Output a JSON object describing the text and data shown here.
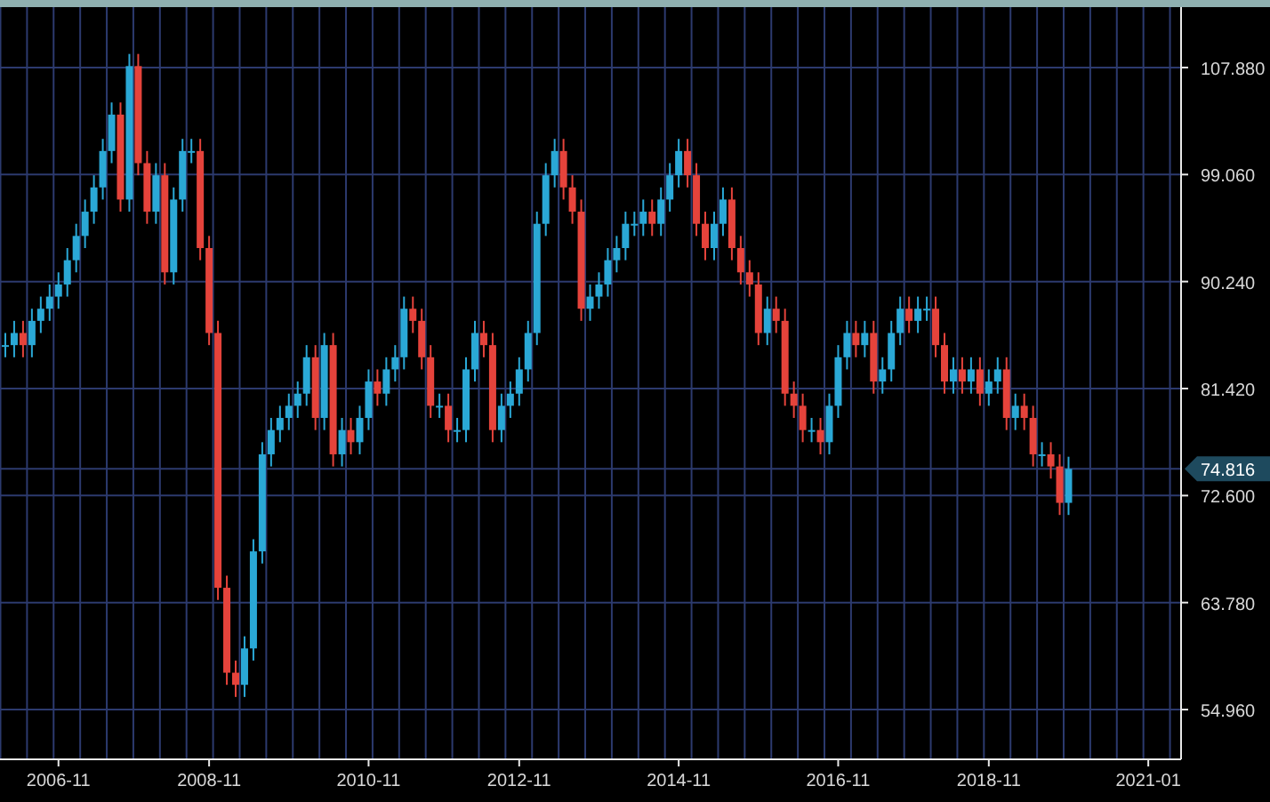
{
  "chart": {
    "chart_data": {
      "type": "candlestick",
      "grid": true,
      "categories": [
        null,
        null,
        null,
        null,
        null,
        null,
        "2006-11",
        null,
        null,
        null,
        null,
        null,
        null,
        null,
        null,
        null,
        null,
        null,
        null,
        null,
        null,
        null,
        null,
        "2008-11",
        null,
        null,
        null,
        null,
        null,
        null,
        null,
        null,
        null,
        null,
        null,
        null,
        null,
        null,
        null,
        null,
        null,
        "2010-11",
        null,
        null,
        null,
        null,
        null,
        null,
        null,
        null,
        null,
        null,
        null,
        null,
        null,
        null,
        null,
        null,
        "2012-11",
        null,
        null,
        null,
        null,
        null,
        null,
        null,
        null,
        null,
        null,
        null,
        null,
        null,
        null,
        null,
        null,
        null,
        "2014-11",
        null,
        null,
        null,
        null,
        null,
        null,
        null,
        null,
        null,
        null,
        null,
        null,
        null,
        null,
        null,
        null,
        null,
        "2016-11",
        null,
        null,
        null,
        null,
        null,
        null,
        null,
        null,
        null,
        null,
        null,
        null,
        null,
        null,
        null,
        null,
        "2018-11",
        null,
        null,
        null,
        null,
        null,
        null,
        null,
        null,
        null,
        null,
        null,
        null,
        null,
        null,
        null,
        null,
        null,
        "2021-01"
      ],
      "ohlc": [
        [
          85,
          86,
          84,
          85
        ],
        [
          85,
          87,
          84,
          86
        ],
        [
          86,
          87,
          84,
          85
        ],
        [
          85,
          88,
          84,
          87
        ],
        [
          87,
          89,
          86,
          88
        ],
        [
          88,
          90,
          87,
          89
        ],
        [
          89,
          91,
          88,
          90
        ],
        [
          90,
          93,
          89,
          92
        ],
        [
          92,
          95,
          91,
          94
        ],
        [
          94,
          97,
          93,
          96
        ],
        [
          96,
          99,
          95,
          98
        ],
        [
          98,
          102,
          97,
          101
        ],
        [
          101,
          105,
          100,
          104
        ],
        [
          104,
          105,
          96,
          97
        ],
        [
          97,
          109,
          96,
          108
        ],
        [
          108,
          109,
          99,
          100
        ],
        [
          100,
          101,
          95,
          96
        ],
        [
          96,
          100,
          95,
          99
        ],
        [
          99,
          100,
          90,
          91
        ],
        [
          91,
          98,
          90,
          97
        ],
        [
          97,
          102,
          96,
          101
        ],
        [
          101,
          102,
          100,
          101
        ],
        [
          101,
          102,
          92,
          93
        ],
        [
          93,
          94,
          85,
          86
        ],
        [
          86,
          87,
          64,
          65
        ],
        [
          65,
          66,
          57,
          58
        ],
        [
          58,
          59,
          56,
          57
        ],
        [
          57,
          61,
          56,
          60
        ],
        [
          60,
          69,
          59,
          68
        ],
        [
          68,
          77,
          67,
          76
        ],
        [
          76,
          79,
          75,
          78
        ],
        [
          78,
          80,
          77,
          79
        ],
        [
          79,
          81,
          78,
          80
        ],
        [
          80,
          82,
          79,
          81
        ],
        [
          81,
          85,
          80,
          84
        ],
        [
          84,
          85,
          78,
          79
        ],
        [
          79,
          86,
          78,
          85
        ],
        [
          85,
          86,
          75,
          76
        ],
        [
          76,
          79,
          75,
          78
        ],
        [
          78,
          79,
          76,
          77
        ],
        [
          77,
          80,
          76,
          79
        ],
        [
          79,
          83,
          78,
          82
        ],
        [
          82,
          83,
          80,
          81
        ],
        [
          81,
          84,
          80,
          83
        ],
        [
          83,
          85,
          82,
          84
        ],
        [
          84,
          89,
          83,
          88
        ],
        [
          88,
          89,
          86,
          87
        ],
        [
          87,
          88,
          83,
          84
        ],
        [
          84,
          85,
          79,
          80
        ],
        [
          80,
          81,
          79,
          80
        ],
        [
          80,
          81,
          77,
          78
        ],
        [
          78,
          79,
          77,
          78
        ],
        [
          78,
          84,
          77,
          83
        ],
        [
          83,
          87,
          82,
          86
        ],
        [
          86,
          87,
          84,
          85
        ],
        [
          85,
          86,
          77,
          78
        ],
        [
          78,
          81,
          77,
          80
        ],
        [
          80,
          82,
          79,
          81
        ],
        [
          81,
          84,
          80,
          83
        ],
        [
          83,
          87,
          82,
          86
        ],
        [
          86,
          96,
          85,
          95
        ],
        [
          95,
          100,
          94,
          99
        ],
        [
          99,
          102,
          98,
          101
        ],
        [
          101,
          102,
          97,
          98
        ],
        [
          98,
          99,
          95,
          96
        ],
        [
          96,
          97,
          87,
          88
        ],
        [
          88,
          90,
          87,
          89
        ],
        [
          89,
          91,
          88,
          90
        ],
        [
          90,
          93,
          89,
          92
        ],
        [
          92,
          94,
          91,
          93
        ],
        [
          93,
          96,
          92,
          95
        ],
        [
          95,
          96,
          94,
          95
        ],
        [
          95,
          97,
          94,
          96
        ],
        [
          96,
          97,
          94,
          95
        ],
        [
          95,
          98,
          94,
          97
        ],
        [
          97,
          100,
          96,
          99
        ],
        [
          99,
          102,
          98,
          101
        ],
        [
          101,
          102,
          98,
          99
        ],
        [
          99,
          100,
          94,
          95
        ],
        [
          95,
          96,
          92,
          93
        ],
        [
          93,
          96,
          92,
          95
        ],
        [
          95,
          98,
          94,
          97
        ],
        [
          97,
          98,
          92,
          93
        ],
        [
          93,
          94,
          90,
          91
        ],
        [
          91,
          92,
          89,
          90
        ],
        [
          90,
          91,
          85,
          86
        ],
        [
          86,
          89,
          85,
          88
        ],
        [
          88,
          89,
          86,
          87
        ],
        [
          87,
          88,
          80,
          81
        ],
        [
          81,
          82,
          79,
          80
        ],
        [
          80,
          81,
          77,
          78
        ],
        [
          78,
          79,
          77,
          78
        ],
        [
          78,
          79,
          76,
          77
        ],
        [
          77,
          81,
          76,
          80
        ],
        [
          80,
          85,
          79,
          84
        ],
        [
          84,
          87,
          83,
          86
        ],
        [
          86,
          87,
          84,
          85
        ],
        [
          85,
          87,
          84,
          86
        ],
        [
          86,
          87,
          81,
          82
        ],
        [
          82,
          84,
          81,
          83
        ],
        [
          83,
          87,
          82,
          86
        ],
        [
          86,
          89,
          85,
          88
        ],
        [
          88,
          89,
          86,
          87
        ],
        [
          87,
          89,
          86,
          88
        ],
        [
          88,
          89,
          87,
          88
        ],
        [
          88,
          89,
          84,
          85
        ],
        [
          85,
          86,
          81,
          82
        ],
        [
          82,
          84,
          81,
          83
        ],
        [
          83,
          84,
          81,
          82
        ],
        [
          82,
          84,
          81,
          83
        ],
        [
          83,
          84,
          80,
          81
        ],
        [
          81,
          83,
          80,
          82
        ],
        [
          82,
          84,
          81,
          83
        ],
        [
          83,
          84,
          78,
          79
        ],
        [
          79,
          81,
          78,
          80
        ],
        [
          80,
          81,
          78,
          79
        ],
        [
          79,
          80,
          75,
          76
        ],
        [
          76,
          77,
          75,
          76
        ],
        [
          76,
          77,
          74,
          75
        ],
        [
          75,
          76,
          71,
          72
        ],
        [
          72,
          75.8,
          71,
          74.8
        ],
        null,
        null,
        null,
        null,
        null,
        null,
        null,
        null,
        null
      ],
      "ylim": [
        50.86,
        112.86
      ],
      "yticks": [
        {
          "value": 107.88,
          "label": "107.880"
        },
        {
          "value": 99.06,
          "label": "99.060"
        },
        {
          "value": 90.24,
          "label": "90.240"
        },
        {
          "value": 81.42,
          "label": "81.420"
        },
        {
          "value": 72.6,
          "label": "72.600"
        },
        {
          "value": 63.78,
          "label": "63.780"
        },
        {
          "value": 54.96,
          "label": "54.960"
        }
      ]
    },
    "last_price": "74.816"
  }
}
